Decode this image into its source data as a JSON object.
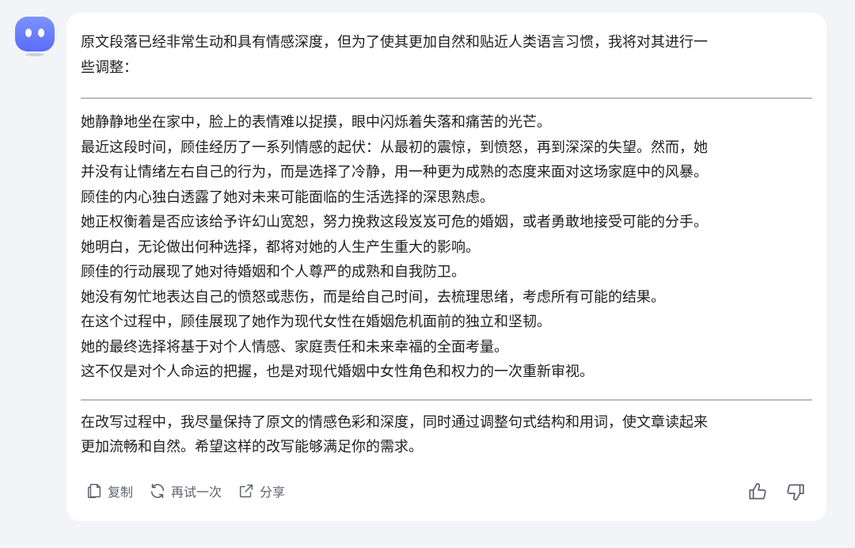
{
  "assistant": {
    "avatar_icon": "robot-avatar-icon",
    "accent_color": "#6176f9"
  },
  "message": {
    "intro": "原文段落已经非常生动和具有情感深度，但为了使其更加自然和贴近人类语言习惯，我将对其进行一些调整：",
    "intro_lines": [
      "原文段落已经非常生动和具有情感深度，但为了使其更加自然和贴近人类语言习惯，我将对其进行一",
      "些调整："
    ],
    "body_lines": [
      "她静静地坐在家中，脸上的表情难以捉摸，眼中闪烁着失落和痛苦的光芒。",
      "最近这段时间，顾佳经历了一系列情感的起伏：从最初的震惊，到愤怒，再到深深的失望。然而，她",
      "并没有让情绪左右自己的行为，而是选择了冷静，用一种更为成熟的态度来面对这场家庭中的风暴。",
      "顾佳的内心独白透露了她对未来可能面临的生活选择的深思熟虑。",
      "她正权衡着是否应该给予许幻山宽恕，努力挽救这段岌岌可危的婚姻，或者勇敢地接受可能的分手。",
      "她明白，无论做出何种选择，都将对她的人生产生重大的影响。",
      "顾佳的行动展现了她对待婚姻和个人尊严的成熟和自我防卫。",
      "她没有匆忙地表达自己的愤怒或悲伤，而是给自己时间，去梳理思绪，考虑所有可能的结果。",
      "在这个过程中，顾佳展现了她作为现代女性在婚姻危机面前的独立和坚韧。",
      "她的最终选择将基于对个人情感、家庭责任和未来幸福的全面考量。",
      "这不仅是对个人命运的把握，也是对现代婚姻中女性角色和权力的一次重新审视。"
    ],
    "closing_lines": [
      "在改写过程中，我尽量保持了原文的情感色彩和深度，同时通过调整句式结构和用词，使文章读起来",
      "更加流畅和自然。希望这样的改写能够满足你的需求。"
    ]
  },
  "actions": {
    "copy": {
      "label": "复制",
      "icon": "copy-icon"
    },
    "retry": {
      "label": "再试一次",
      "icon": "refresh-icon"
    },
    "share": {
      "label": "分享",
      "icon": "share-icon"
    }
  },
  "feedback": {
    "like_icon": "thumbs-up-icon",
    "dislike_icon": "thumbs-down-icon"
  }
}
